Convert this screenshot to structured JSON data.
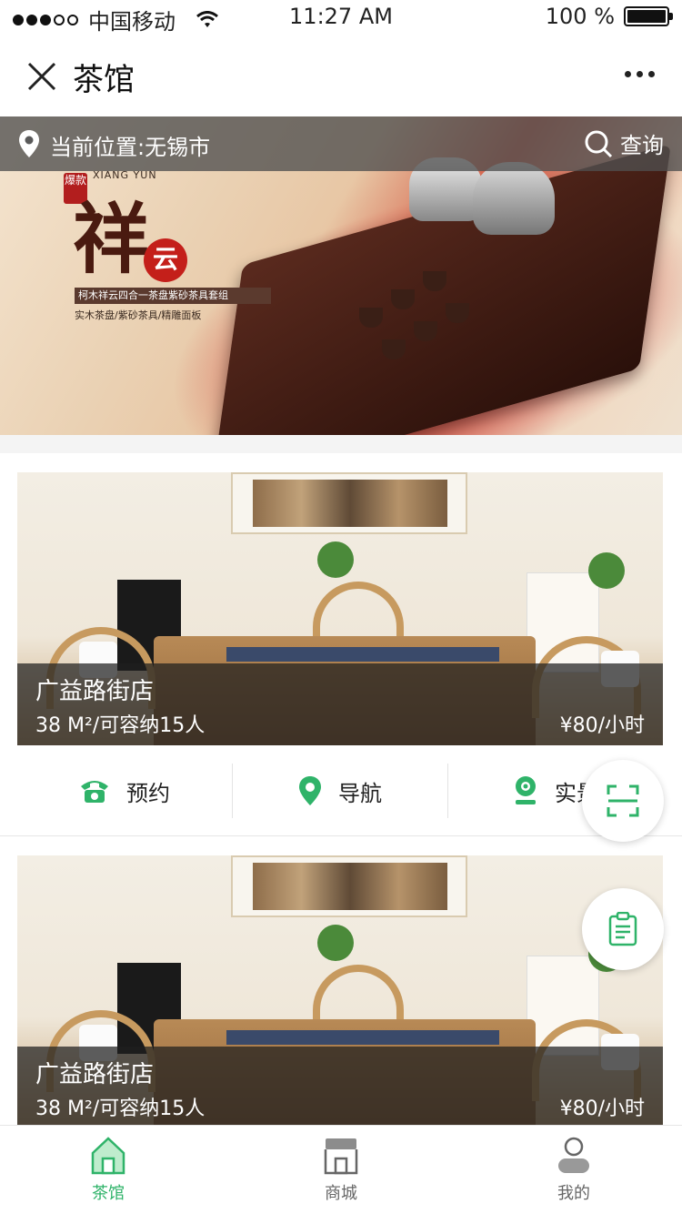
{
  "status_bar": {
    "carrier": "中国移动",
    "time": "11:27 AM",
    "battery_percent": "100 %"
  },
  "nav": {
    "title": "茶馆",
    "close_icon": "close-icon",
    "more_icon": "more-icon"
  },
  "banner": {
    "location": "当前位置:无锡市",
    "search_label": "查询",
    "brand_seal": "爆款",
    "brand_en": "XIANG YUN",
    "brand_main": "祥",
    "brand_circle": "云",
    "brand_tag": "柯木祥云四合一茶盘紫砂茶具套组",
    "brand_sub": "实木茶盘/紫砂茶具/精雕面板"
  },
  "stores": [
    {
      "name": "广益路街店",
      "info": "38 M²/可容纳15人",
      "price": "¥80/小时"
    },
    {
      "name": "广益路街店",
      "info": "38 M²/可容纳15人",
      "price": "¥80/小时"
    }
  ],
  "actions": {
    "reserve": "预约",
    "navigate": "导航",
    "live_view": "实景"
  },
  "tabs": [
    {
      "label": "茶馆",
      "icon": "house-icon",
      "active": true
    },
    {
      "label": "商城",
      "icon": "shop-icon",
      "active": false
    },
    {
      "label": "我的",
      "icon": "user-icon",
      "active": false
    }
  ],
  "colors": {
    "accent": "#2fb369",
    "overlay": "#333333"
  }
}
